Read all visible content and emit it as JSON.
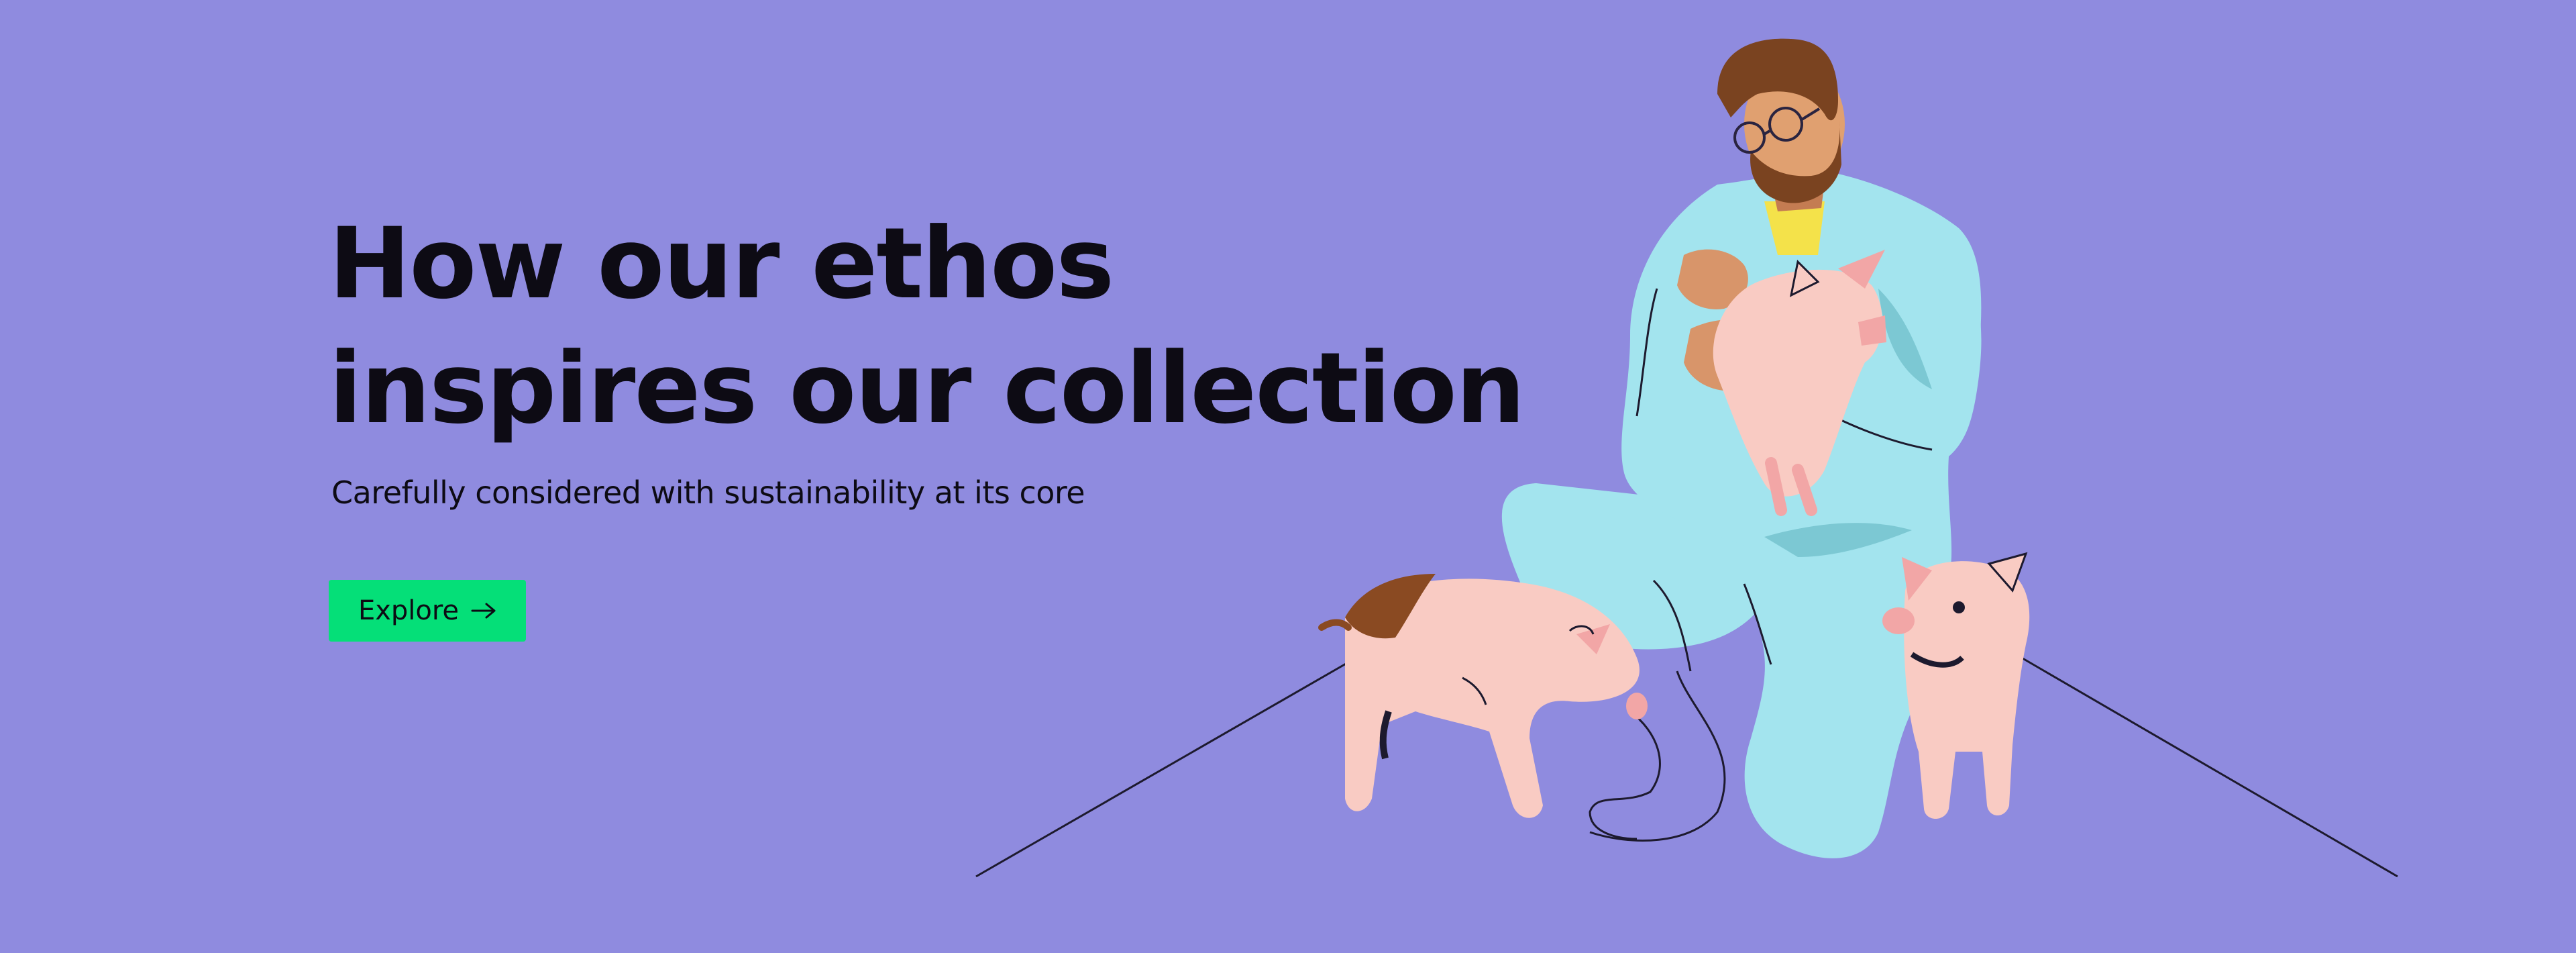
{
  "hero": {
    "title_line_1": "How our ethos",
    "title_line_2": "inspires our collection",
    "subtitle": "Carefully considered with sustainability at its core",
    "cta_label": "Explore",
    "cta_icon": "arrow-right-icon"
  },
  "illustration": {
    "subject": "farmer-holding-piglet",
    "background_color": "#8f8bdf",
    "accent_color": "#05df78",
    "outfit_color": "#a3e4ee",
    "pig_color": "#f9cbc3"
  }
}
